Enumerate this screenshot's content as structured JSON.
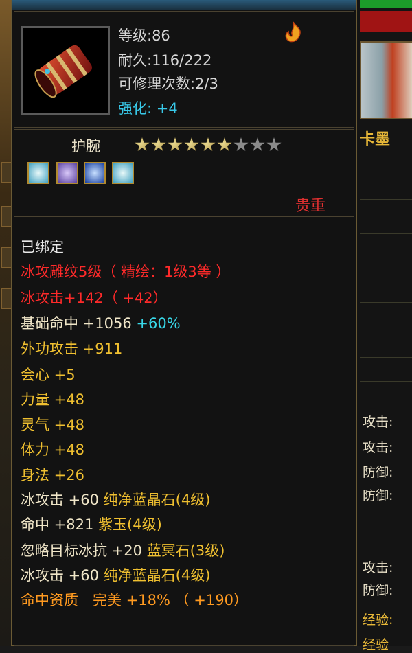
{
  "item": {
    "level": "等级:86",
    "durability": "耐久:116/222",
    "repairs": "可修理次数:2/3",
    "enhance_label": "强化:",
    "enhance_value": "+4",
    "name": "护腕",
    "stars_total": 9,
    "stars_filled": 6,
    "rarity": "贵重",
    "gems": [
      "ice-gem-icon",
      "purple-jade-icon",
      "blue-crystal-icon",
      "ice-gem-icon"
    ]
  },
  "attributes": [
    {
      "text": "已绑定",
      "color": "white"
    },
    {
      "text": "冰攻雕纹5级（ 精绘：1级3等 ）",
      "color": "red"
    },
    {
      "text": "冰攻击+142（ +42）",
      "color": "red"
    },
    {
      "text": "基础命中 +1056",
      "extra": "+60%",
      "color": "cream"
    },
    {
      "text": "外功攻击 +911",
      "color": "gold"
    },
    {
      "text": "会心 +5",
      "color": "gold"
    },
    {
      "text": "力量 +48",
      "color": "gold"
    },
    {
      "text": "灵气 +48",
      "color": "gold"
    },
    {
      "text": "体力 +48",
      "color": "gold"
    },
    {
      "text": "身法 +26",
      "color": "gold"
    },
    {
      "text": "冰攻击 +60",
      "gemtext": "纯净蓝晶石(4级)",
      "color": "cream"
    },
    {
      "text": "命中 +821",
      "gemtext": "紫玉(4级)",
      "color": "cream"
    },
    {
      "text": "忽略目标冰抗 +20",
      "gemtext": "蓝冥石(3级)",
      "color": "cream"
    },
    {
      "text": "冰攻击 +60",
      "gemtext": "纯净蓝晶石(4级)",
      "color": "cream"
    },
    {
      "text": "命中资质　完美 +18% （ +190）",
      "color": "orange"
    }
  ],
  "right_panel": {
    "title_fragment": "卡墨",
    "labels": [
      "攻击:",
      "攻击:",
      "防御:",
      "防御:",
      "攻击:",
      "防御:",
      "经验:",
      "经验"
    ]
  }
}
